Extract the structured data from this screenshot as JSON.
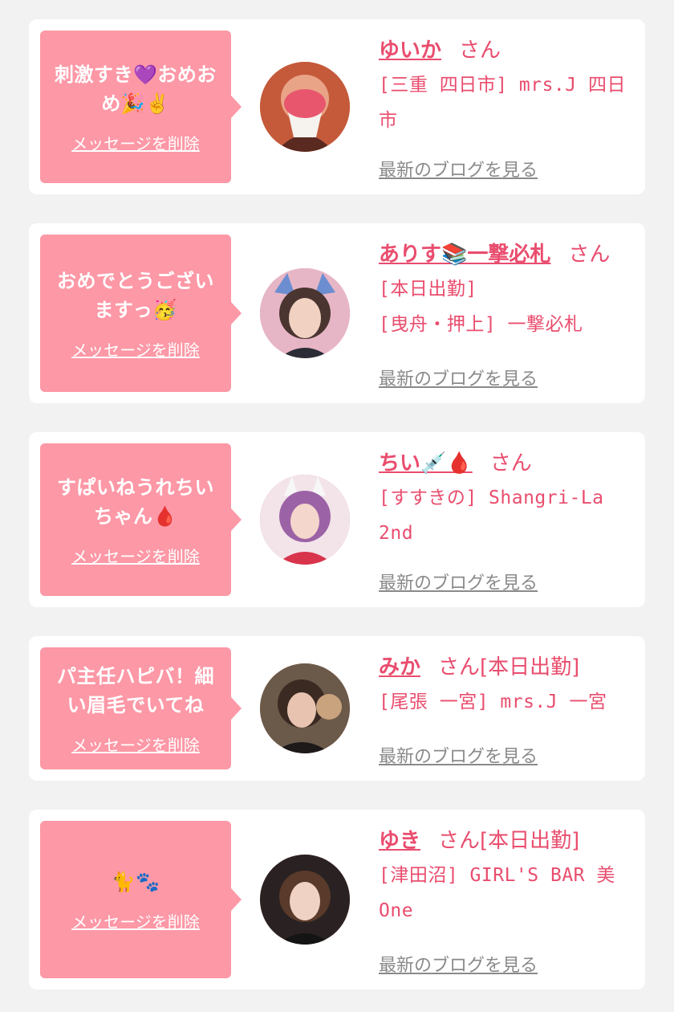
{
  "delete_label": "メッセージを削除",
  "blog_label": "最新のブログを見る",
  "colors": {
    "accent": "#e94d6e",
    "bubble": "#fd98a6",
    "card": "#ffffff",
    "background": "#f2f2f2"
  },
  "messages": [
    {
      "text": "刺激すき💜おめおめ🎉✌️",
      "name": "ゆいか",
      "honorific": "さん",
      "details": [
        "[三重 四日市] mrs.J 四日市"
      ]
    },
    {
      "text": "おめでとうございますっ🥳",
      "name": "ありす📚一撃必札",
      "honorific": "さん",
      "details": [
        "[本日出勤]",
        "[曳舟・押上] 一撃必札"
      ]
    },
    {
      "text": "すぱいねうれちいちゃん🩸",
      "name": "ちい💉🩸",
      "honorific": "さん",
      "details": [
        "[すすきの] Shangri-La 2nd"
      ]
    },
    {
      "text": "パ主任ハピバ！細い眉毛でいてね",
      "name": "みか",
      "honorific": "さん[本日出勤]",
      "details": [
        "[尾張 一宮] mrs.J 一宮"
      ]
    },
    {
      "text": "🐈🐾",
      "name": "ゆき",
      "honorific": "さん[本日出勤]",
      "details": [
        "[津田沼] GIRL'S BAR 美 One"
      ]
    }
  ]
}
